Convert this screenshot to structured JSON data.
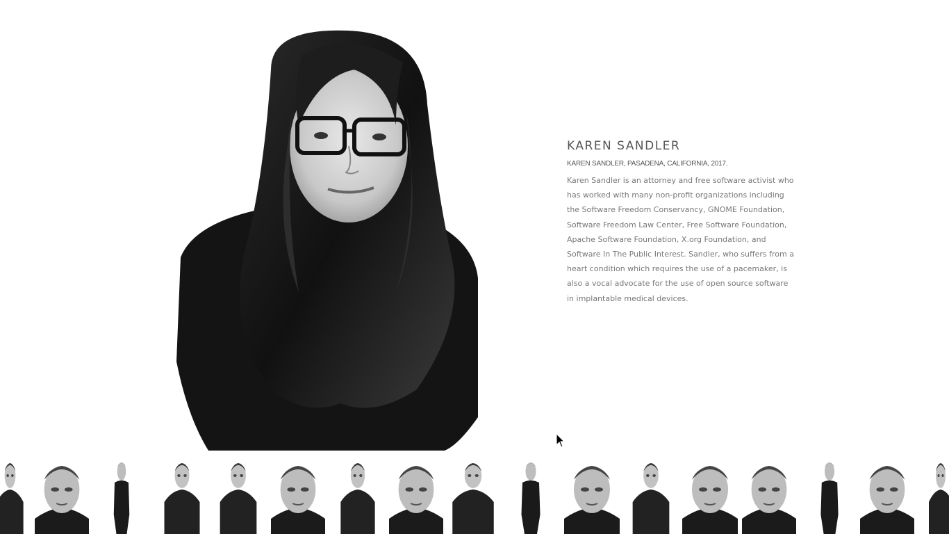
{
  "featured": {
    "name": "KAREN SANDLER",
    "caption": "KAREN SANDLER, PASADENA, CALIFORNIA, 2017.",
    "bio": "Karen Sandler is an attorney and free software activist who has worked with many non-profit organizations including the Software Freedom Conservancy, GNOME Foundation, Software Freedom Law Center, Free Software Foundation, Apache Software Foundation, X.org Foundation, and Software In The Public Interest. Sandler, who suffers from a heart condition which requires the use of a pacemaker, is also a vocal advocate for the use of open source software in implantable medical devices."
  },
  "thumbnails": [
    {
      "pose": "torso"
    },
    {
      "pose": "closeup"
    },
    {
      "pose": "fullbody"
    },
    {
      "pose": "torso"
    },
    {
      "pose": "torso"
    },
    {
      "pose": "closeup"
    },
    {
      "pose": "torso"
    },
    {
      "pose": "closeup"
    },
    {
      "pose": "torso"
    },
    {
      "pose": "fullbody"
    },
    {
      "pose": "closeup"
    },
    {
      "pose": "torso"
    },
    {
      "pose": "closeup"
    },
    {
      "pose": "closeup"
    },
    {
      "pose": "fullbody"
    },
    {
      "pose": "closeup"
    },
    {
      "pose": "torso"
    }
  ],
  "colors": {
    "background": "#ffffff",
    "text": "#666666",
    "photo_dark": "#1a1a1a"
  }
}
